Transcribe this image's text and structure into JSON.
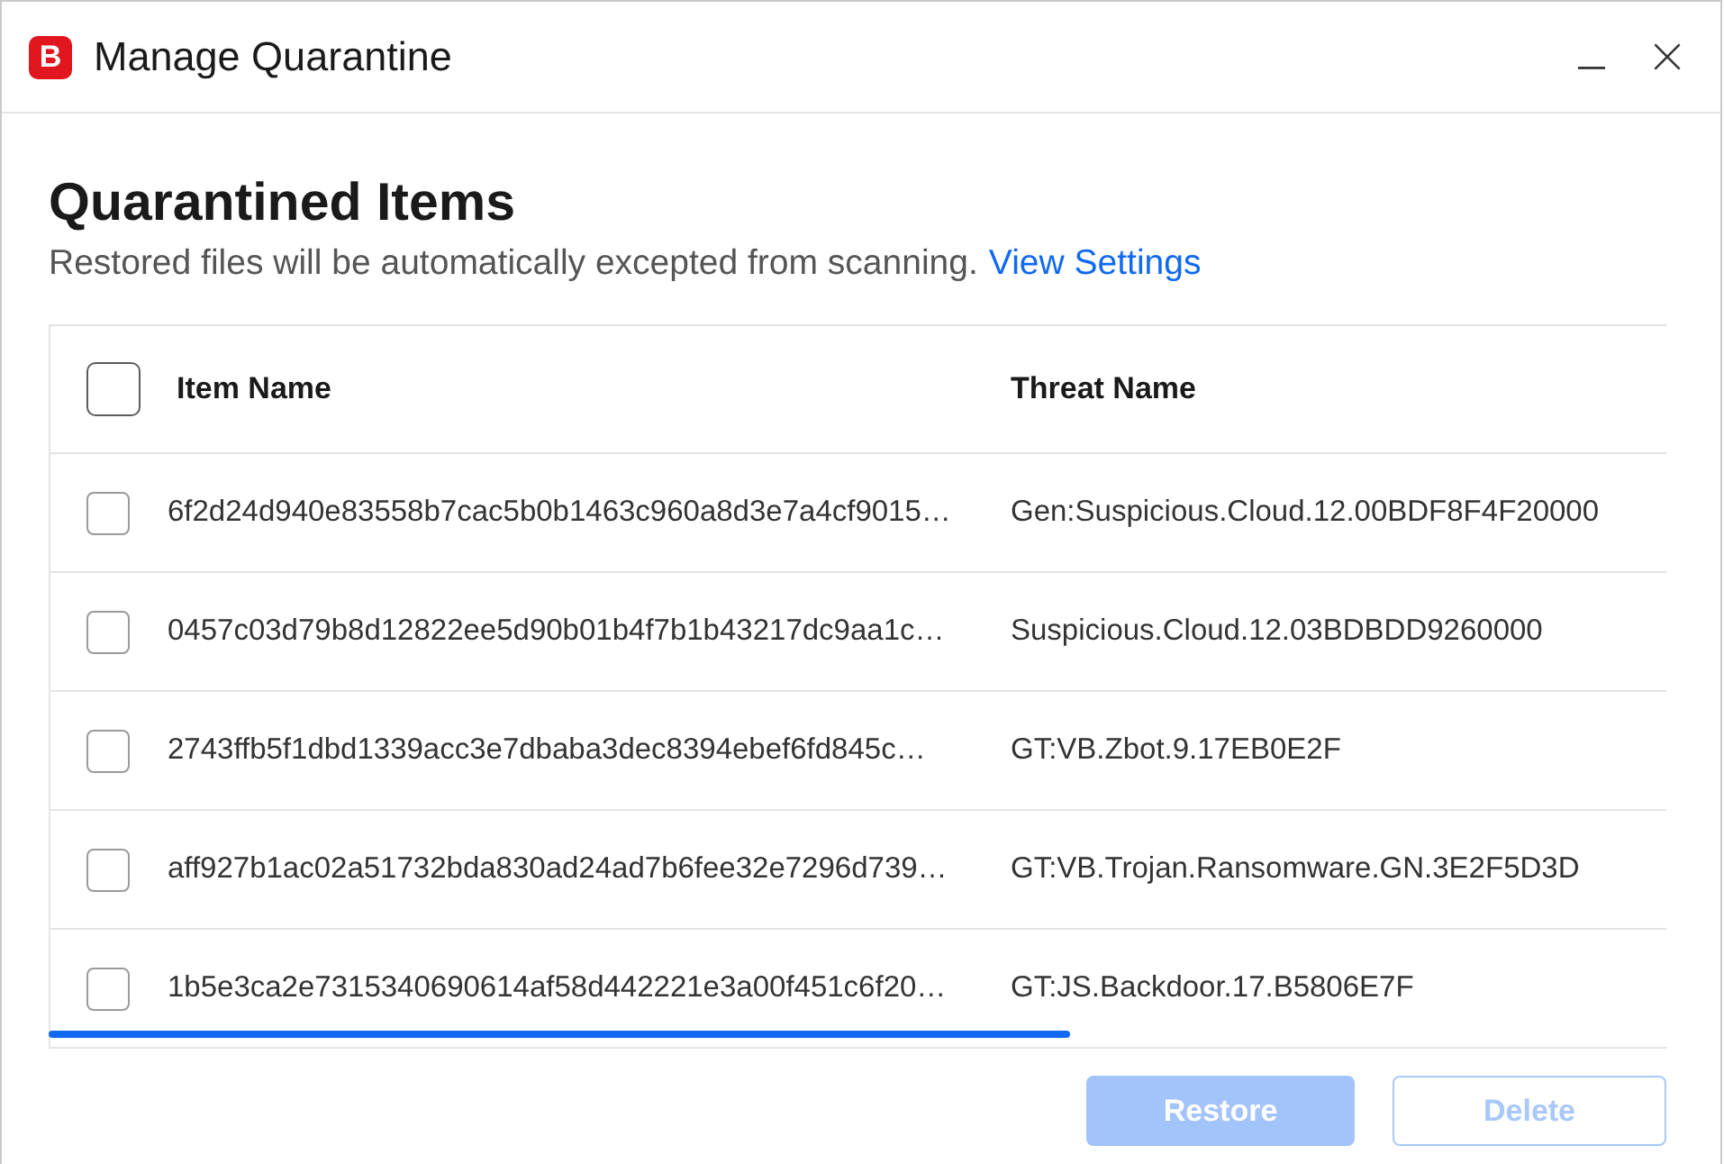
{
  "window": {
    "logo": "B",
    "title": "Manage Quarantine"
  },
  "header": {
    "title": "Quarantined Items",
    "description": "Restored files will be automatically excepted from scanning.",
    "link": "View Settings"
  },
  "table": {
    "select_all": {
      "checked": false
    },
    "columns": [
      "Item Name",
      "Threat Name"
    ],
    "rows": [
      {
        "checked": false,
        "item_name": "6f2d24d940e83558b7cac5b0b1463c960a8d3e7a4cf9015…",
        "threat_name": "Gen:Suspicious.Cloud.12.00BDF8F4F20000"
      },
      {
        "checked": false,
        "item_name": "0457c03d79b8d12822ee5d90b01b4f7b1b43217dc9aa1c…",
        "threat_name": "Suspicious.Cloud.12.03BDBDD9260000"
      },
      {
        "checked": false,
        "item_name": "2743ffb5f1dbd1339acc3e7dbaba3dec8394ebef6fd845c…",
        "threat_name": "GT:VB.Zbot.9.17EB0E2F"
      },
      {
        "checked": false,
        "item_name": "aff927b1ac02a51732bda830ad24ad7b6fee32e7296d739…",
        "threat_name": "GT:VB.Trojan.Ransomware.GN.3E2F5D3D"
      },
      {
        "checked": false,
        "item_name": "1b5e3ca2e7315340690614af58d442221e3a00f451c6f20…",
        "threat_name": "GT:JS.Backdoor.17.B5806E7F"
      }
    ]
  },
  "buttons": [
    {
      "label": "Restore",
      "kind": "primary",
      "disabled": true
    },
    {
      "label": "Delete",
      "kind": "secondary",
      "disabled": true
    }
  ]
}
